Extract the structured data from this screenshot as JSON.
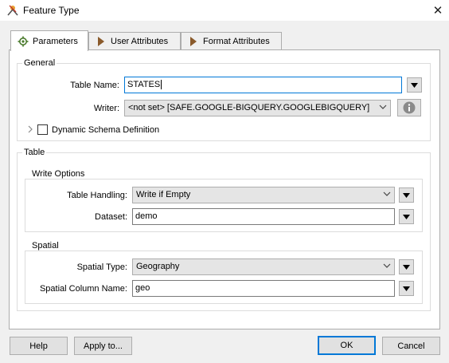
{
  "window": {
    "title": "Feature Type",
    "close_glyph": "✕"
  },
  "tabs": [
    {
      "label": "Parameters",
      "icon": "gear-icon"
    },
    {
      "label": "User Attributes",
      "icon": "arrow-right-icon"
    },
    {
      "label": "Format Attributes",
      "icon": "arrow-right-icon"
    }
  ],
  "general": {
    "title": "General",
    "table_name_label": "Table Name:",
    "table_name_value": "STATES",
    "writer_label": "Writer:",
    "writer_value": "<not set> [SAFE.GOOGLE-BIGQUERY.GOOGLEBIGQUERY]",
    "dynamic_schema_label": "Dynamic Schema Definition",
    "dynamic_schema_checked": false
  },
  "table": {
    "title": "Table",
    "write_options": {
      "title": "Write Options",
      "table_handling_label": "Table Handling:",
      "table_handling_value": "Write if Empty",
      "dataset_label": "Dataset:",
      "dataset_value": "demo"
    },
    "spatial": {
      "title": "Spatial",
      "spatial_type_label": "Spatial Type:",
      "spatial_type_value": "Geography",
      "spatial_column_label": "Spatial Column Name:",
      "spatial_column_value": "geo"
    }
  },
  "footer": {
    "help": "Help",
    "apply_to": "Apply to...",
    "ok": "OK",
    "cancel": "Cancel"
  },
  "colors": {
    "accent": "#0078d7",
    "icon_brown": "#8a5a2b",
    "info_gray": "#8a8a8a"
  }
}
